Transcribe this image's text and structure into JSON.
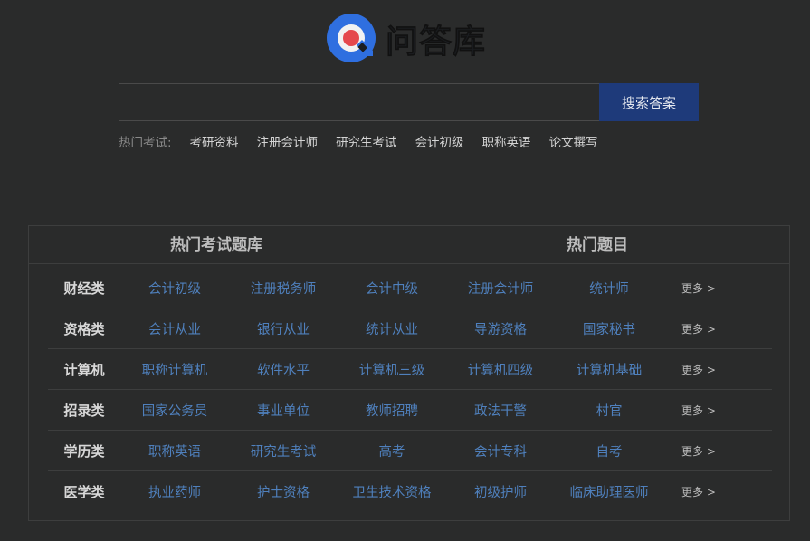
{
  "logo": {
    "text": "问答库",
    "icon": "q-logo-icon"
  },
  "search": {
    "value": "",
    "placeholder": "",
    "button_label": "搜索答案"
  },
  "hot_exams": {
    "label": "热门考试:",
    "links": [
      "考研资料",
      "注册会计师",
      "研究生考试",
      "会计初级",
      "职称英语",
      "论文撰写"
    ]
  },
  "panel": {
    "title_left": "热门考试题库",
    "title_right": "热门题目",
    "more_label": "更多 >",
    "rows": [
      {
        "category": "财经类",
        "links": [
          "会计初级",
          "注册税务师",
          "会计中级",
          "注册会计师",
          "统计师"
        ]
      },
      {
        "category": "资格类",
        "links": [
          "会计从业",
          "银行从业",
          "统计从业",
          "导游资格",
          "国家秘书"
        ]
      },
      {
        "category": "计算机",
        "links": [
          "职称计算机",
          "软件水平",
          "计算机三级",
          "计算机四级",
          "计算机基础"
        ]
      },
      {
        "category": "招录类",
        "links": [
          "国家公务员",
          "事业单位",
          "教师招聘",
          "政法干警",
          "村官"
        ]
      },
      {
        "category": "学历类",
        "links": [
          "职称英语",
          "研究生考试",
          "高考",
          "会计专科",
          "自考"
        ]
      },
      {
        "category": "医学类",
        "links": [
          "执业药师",
          "护士资格",
          "卫生技术资格",
          "初级护师",
          "临床助理医师"
        ]
      }
    ]
  },
  "colors": {
    "background": "#2a2b2b",
    "link": "#4f80bd",
    "button": "#1e3a7a",
    "logo_blue": "#2f6fe0",
    "logo_red": "#e5484d"
  }
}
